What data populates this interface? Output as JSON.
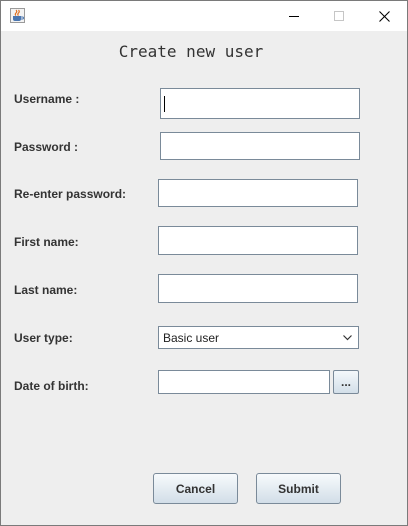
{
  "window": {
    "icon": "java-cup-icon",
    "controls": [
      "minimize-icon",
      "maximize-icon",
      "close-icon"
    ]
  },
  "form": {
    "title": "Create new user",
    "username_label": "Username :",
    "username_value": "",
    "password_label": "Password :",
    "password_value": "",
    "reenter_label": "Re-enter password:",
    "reenter_value": "",
    "firstname_label": "First name:",
    "firstname_value": "",
    "lastname_label": "Last name:",
    "lastname_value": "",
    "usertype_label": "User type:",
    "usertype_selected": "Basic user",
    "dob_label": "Date of birth:",
    "dob_value": "",
    "dob_picker_label": "..."
  },
  "buttons": {
    "cancel_label": "Cancel",
    "submit_label": "Submit"
  }
}
